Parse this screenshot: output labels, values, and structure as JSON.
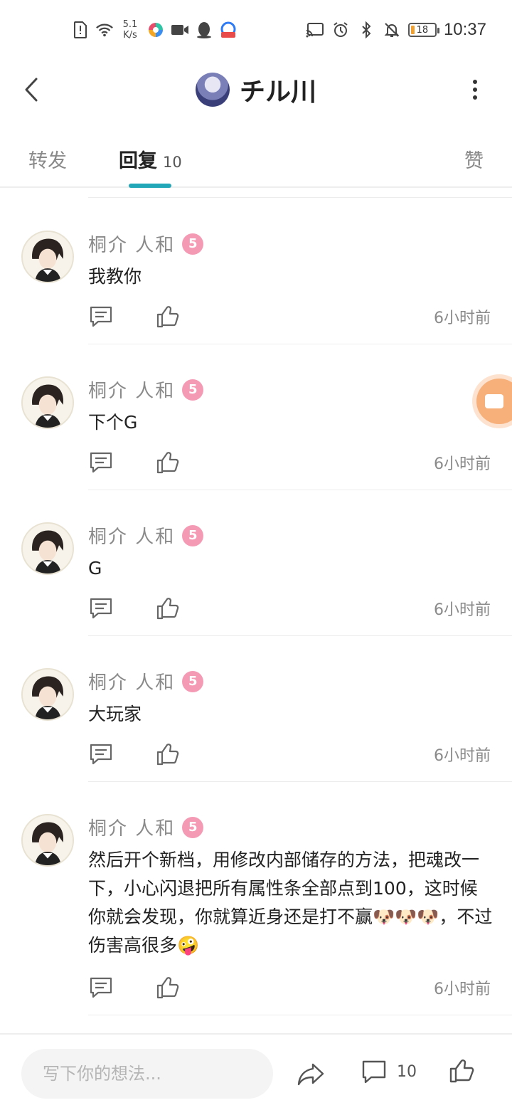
{
  "status_bar": {
    "net_speed_value": "5.1",
    "net_speed_unit": "K/s",
    "battery_level": "18",
    "time": "10:37",
    "left_icons": [
      "sim-alert-icon",
      "wifi-icon",
      "colorful-app-icon",
      "video-camera-icon",
      "qq-penguin-icon",
      "baidu-app-icon"
    ],
    "right_icons": [
      "cast-icon",
      "alarm-icon",
      "bluetooth-icon",
      "mute-bell-icon",
      "battery-icon"
    ]
  },
  "header": {
    "title": "チル川",
    "back_icon": "chevron-left-icon",
    "more_icon": "more-vertical-icon"
  },
  "tabs": {
    "forward_label": "转发",
    "reply_label": "回复",
    "reply_count": "10",
    "like_label": "赞",
    "active": "reply",
    "accent_color": "#21a7b8"
  },
  "replies": [
    {
      "name": "桐介  人和",
      "badge": "5",
      "text": "我教你",
      "time": "6小时前"
    },
    {
      "name": "桐介  人和",
      "badge": "5",
      "text": "下个G",
      "time": "6小时前"
    },
    {
      "name": "桐介  人和",
      "badge": "5",
      "text": "G",
      "time": "6小时前"
    },
    {
      "name": "桐介  人和",
      "badge": "5",
      "text": "大玩家",
      "time": "6小时前"
    },
    {
      "name": "桐介  人和",
      "badge": "5",
      "text": "然后开个新档，用修改内部储存的方法，把魂改一下，小心闪退把所有属性条全部点到100，这时候你就会发现，你就算近身还是打不赢🐶🐶🐶，不过伤害高很多🤪",
      "time": "6小时前"
    }
  ],
  "bottom_bar": {
    "input_placeholder": "写下你的想法...",
    "comment_count": "10",
    "share_icon": "share-arrow-icon",
    "comment_icon": "comment-bubble-icon",
    "like_icon": "thumbs-up-icon"
  },
  "colors": {
    "badge": "#f59ab5",
    "floating_button": "#f7b07a"
  }
}
